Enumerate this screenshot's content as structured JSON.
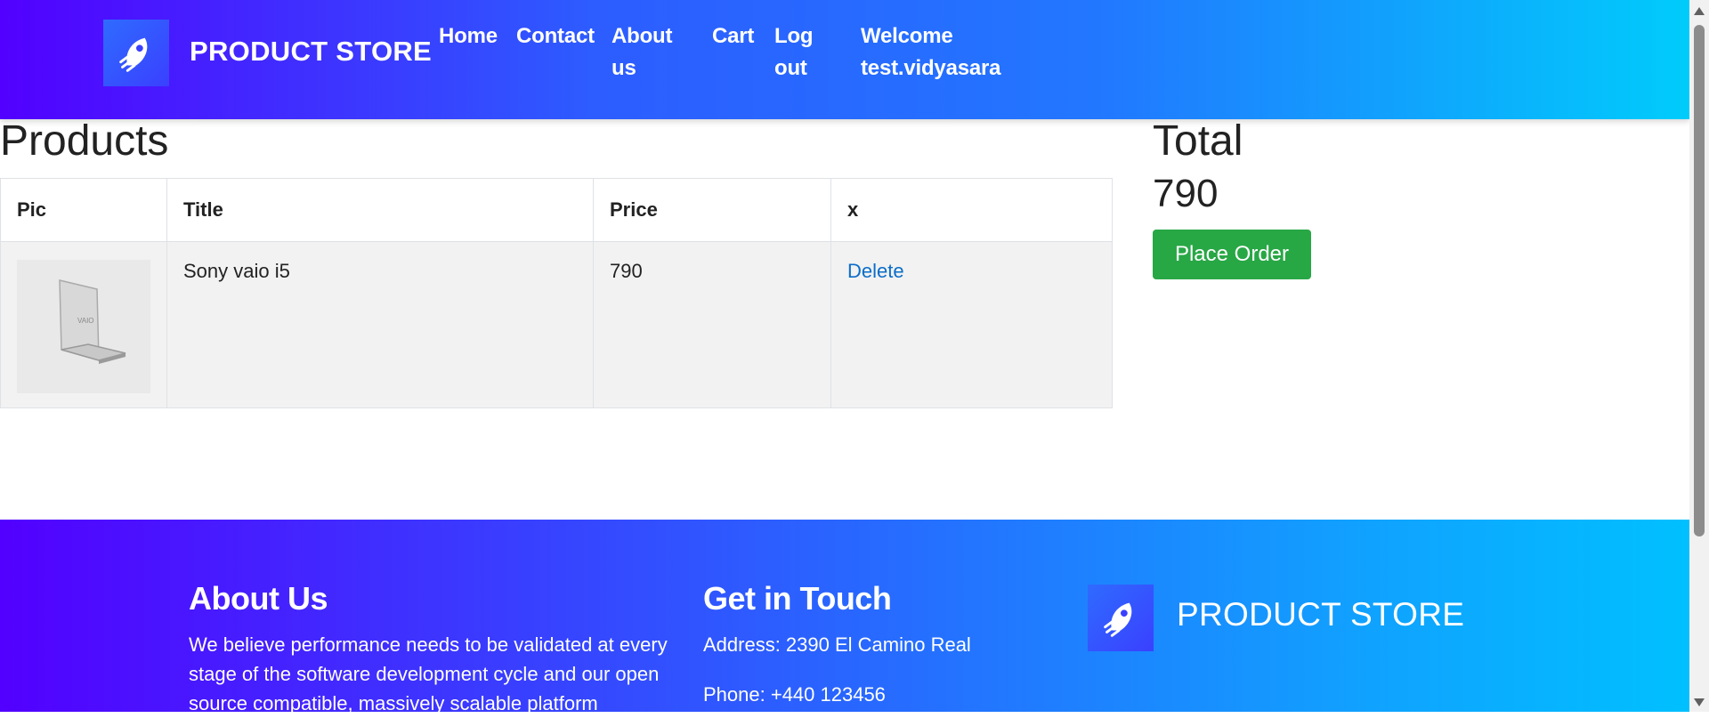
{
  "navbar": {
    "brand": "PRODUCT STORE",
    "links": [
      "Home",
      "Contact",
      "About us",
      "Cart",
      "Log out",
      "Welcome test.vidyasara"
    ]
  },
  "products_heading": "Products",
  "table": {
    "headers": [
      "Pic",
      "Title",
      "Price",
      "x"
    ],
    "rows": [
      {
        "image": "sony-vaio-laptop-image",
        "title": "Sony vaio i5",
        "price": "790",
        "action": "Delete"
      }
    ]
  },
  "summary": {
    "total_label": "Total",
    "total_value": "790",
    "place_order": "Place Order"
  },
  "footer": {
    "about_title": "About Us",
    "about_text": "We believe performance needs to be validated at every stage of the software development cycle and our open source compatible, massively scalable platform",
    "contact_title": "Get in Touch",
    "address": "Address: 2390 El Camino Real",
    "phone": "Phone: +440 123456",
    "brand": "PRODUCT STORE"
  },
  "colors": {
    "navbar_gradient": [
      "#5200ff",
      "#00ccfb"
    ],
    "place_order_button": "#28a745",
    "delete_link": "#0b6dc9"
  }
}
